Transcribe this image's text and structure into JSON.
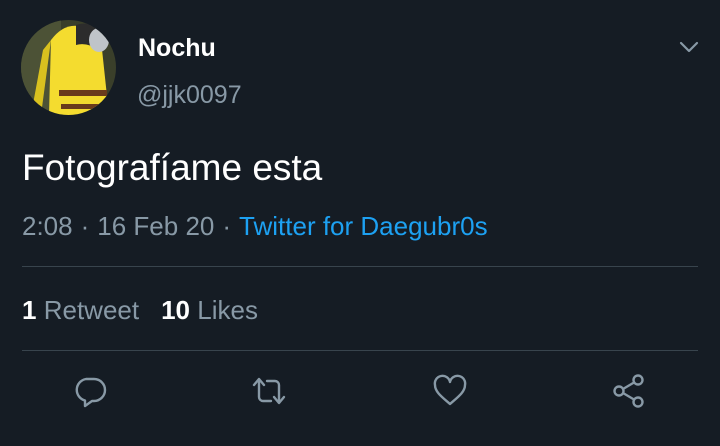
{
  "user": {
    "display_name": "Nochu",
    "handle": "@jjk0097"
  },
  "tweet": {
    "text": "Fotografíame esta",
    "time": "2:08",
    "separator": "·",
    "date": "16 Feb 20",
    "source": "Twitter for Daegubr0s"
  },
  "stats": {
    "retweets_count": "1",
    "retweets_label": "Retweet",
    "likes_count": "10",
    "likes_label": "Likes"
  },
  "actions": [
    {
      "icon": "reply-icon"
    },
    {
      "icon": "retweet-icon"
    },
    {
      "icon": "heart-icon"
    },
    {
      "icon": "share-icon"
    }
  ],
  "colors": {
    "background": "#151c24",
    "secondary_text": "#8899a6",
    "link": "#1da1f2",
    "divider": "#38444d"
  }
}
